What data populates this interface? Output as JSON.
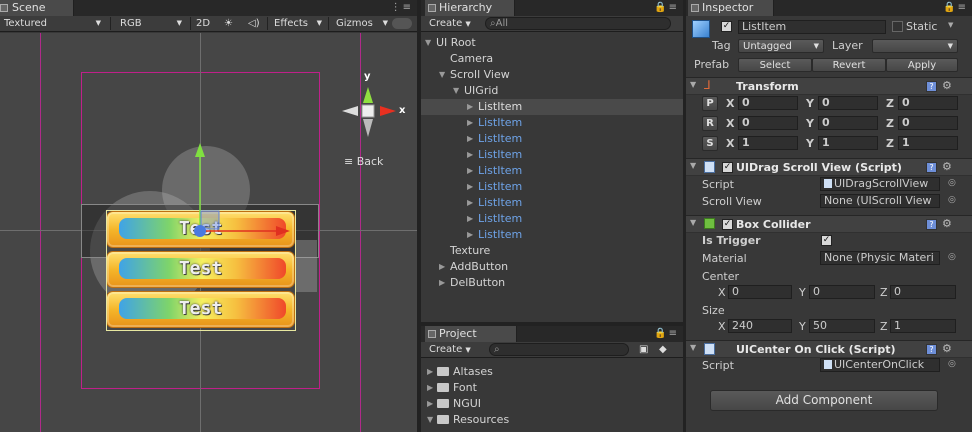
{
  "scene": {
    "tab": "Scene",
    "toolbar": {
      "render_mode": "Textured",
      "color_mode": "RGB",
      "mode_2d": "2D",
      "audio_icon": "speaker-icon",
      "effects": "Effects",
      "gizmos": "Gizmos"
    },
    "buttons": [
      "Test",
      "Test",
      "Test"
    ],
    "gizmo": {
      "y": "y",
      "x": "x"
    },
    "back": "Back"
  },
  "hierarchy": {
    "tab": "Hierarchy",
    "create": "Create",
    "search_placeholder": "All",
    "items": [
      {
        "label": "UI Root"
      },
      {
        "label": "Camera"
      },
      {
        "label": "Scroll View"
      },
      {
        "label": "UIGrid"
      },
      {
        "label": "ListItem"
      },
      {
        "label": "ListItem"
      },
      {
        "label": "ListItem"
      },
      {
        "label": "ListItem"
      },
      {
        "label": "ListItem"
      },
      {
        "label": "ListItem"
      },
      {
        "label": "ListItem"
      },
      {
        "label": "ListItem"
      },
      {
        "label": "ListItem"
      },
      {
        "label": "Texture"
      },
      {
        "label": "AddButton"
      },
      {
        "label": "DelButton"
      }
    ]
  },
  "project": {
    "tab": "Project",
    "create": "Create",
    "folders": [
      "Altases",
      "Font",
      "NGUI",
      "Resources"
    ]
  },
  "inspector": {
    "tab": "Inspector",
    "object_name": "ListItem",
    "static_label": "Static",
    "tag_label": "Tag",
    "tag_value": "Untagged",
    "layer_label": "Layer",
    "layer_value": "",
    "prefab_label": "Prefab",
    "prefab_select": "Select",
    "prefab_revert": "Revert",
    "prefab_apply": "Apply",
    "transform": {
      "title": "Transform",
      "rows": [
        {
          "btn": "P",
          "x": "0",
          "y": "0",
          "z": "0"
        },
        {
          "btn": "R",
          "x": "0",
          "y": "0",
          "z": "0"
        },
        {
          "btn": "S",
          "x": "1",
          "y": "1",
          "z": "1"
        }
      ],
      "xl": "X",
      "yl": "Y",
      "zl": "Z"
    },
    "drag_scroll": {
      "title": "UIDrag Scroll View (Script)",
      "script_label": "Script",
      "script_value": "UIDragScrollView",
      "sv_label": "Scroll View",
      "sv_value": "None (UIScroll View"
    },
    "box_collider": {
      "title": "Box Collider",
      "trigger_label": "Is Trigger",
      "material_label": "Material",
      "material_value": "None (Physic Materi",
      "center_label": "Center",
      "center": {
        "x": "0",
        "y": "0",
        "z": "0"
      },
      "size_label": "Size",
      "size": {
        "x": "240",
        "y": "50",
        "z": "1"
      }
    },
    "center_click": {
      "title": "UICenter On Click (Script)",
      "script_label": "Script",
      "script_value": "UICenterOnClick"
    },
    "add_component": "Add Component"
  }
}
